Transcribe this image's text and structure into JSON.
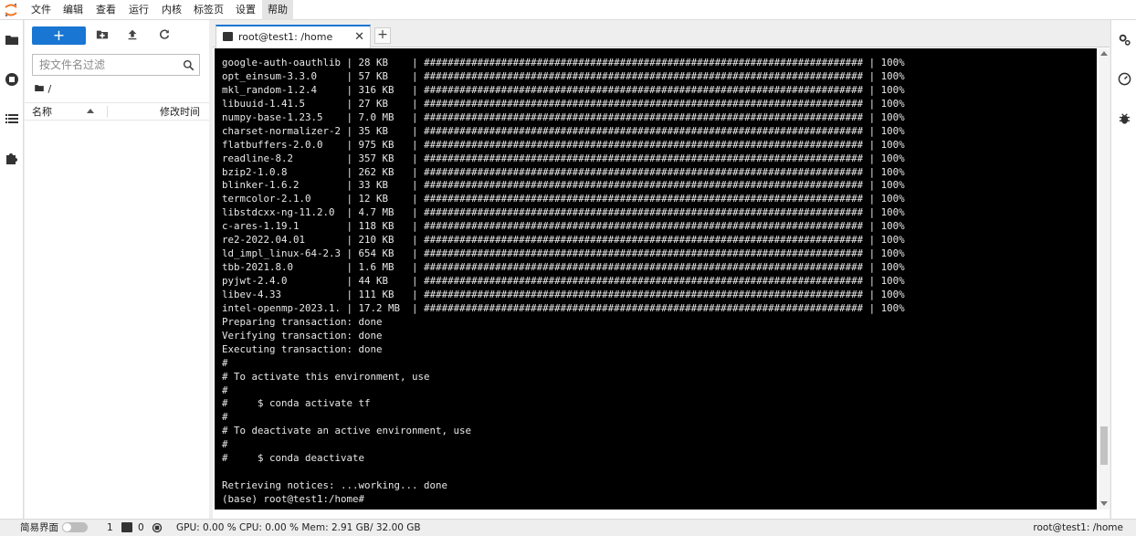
{
  "menubar": {
    "items": [
      "文件",
      "编辑",
      "查看",
      "运行",
      "内核",
      "标签页",
      "设置",
      "帮助"
    ],
    "active": "帮助"
  },
  "filebrowser": {
    "new_label": "+",
    "search_placeholder": "按文件名过滤",
    "path": "/",
    "col_name": "名称",
    "col_modified": "修改时间"
  },
  "tab": {
    "title": "root@test1: /home",
    "close": "✕",
    "add": "+"
  },
  "terminal": {
    "packages": [
      {
        "name": "google-auth-oauthlib",
        "size": "28 KB",
        "pct": "100%"
      },
      {
        "name": "opt_einsum-3.3.0",
        "size": "57 KB",
        "pct": "100%"
      },
      {
        "name": "mkl_random-1.2.4",
        "size": "316 KB",
        "pct": "100%"
      },
      {
        "name": "libuuid-1.41.5",
        "size": "27 KB",
        "pct": "100%"
      },
      {
        "name": "numpy-base-1.23.5",
        "size": "7.0 MB",
        "pct": "100%"
      },
      {
        "name": "charset-normalizer-2",
        "size": "35 KB",
        "pct": "100%"
      },
      {
        "name": "flatbuffers-2.0.0",
        "size": "975 KB",
        "pct": "100%"
      },
      {
        "name": "readline-8.2",
        "size": "357 KB",
        "pct": "100%"
      },
      {
        "name": "bzip2-1.0.8",
        "size": "262 KB",
        "pct": "100%"
      },
      {
        "name": "blinker-1.6.2",
        "size": "33 KB",
        "pct": "100%"
      },
      {
        "name": "termcolor-2.1.0",
        "size": "12 KB",
        "pct": "100%"
      },
      {
        "name": "libstdcxx-ng-11.2.0",
        "size": "4.7 MB",
        "pct": "100%"
      },
      {
        "name": "c-ares-1.19.1",
        "size": "118 KB",
        "pct": "100%"
      },
      {
        "name": "re2-2022.04.01",
        "size": "210 KB",
        "pct": "100%"
      },
      {
        "name": "ld_impl_linux-64-2.3",
        "size": "654 KB",
        "pct": "100%"
      },
      {
        "name": "tbb-2021.8.0",
        "size": "1.6 MB",
        "pct": "100%"
      },
      {
        "name": "pyjwt-2.4.0",
        "size": "44 KB",
        "pct": "100%"
      },
      {
        "name": "libev-4.33",
        "size": "111 KB",
        "pct": "100%"
      },
      {
        "name": "intel-openmp-2023.1.",
        "size": "17.2 MB",
        "pct": "100%"
      }
    ],
    "lines": [
      "Preparing transaction: done",
      "Verifying transaction: done",
      "Executing transaction: done",
      "#",
      "# To activate this environment, use",
      "#",
      "#     $ conda activate tf",
      "#",
      "# To deactivate an active environment, use",
      "#",
      "#     $ conda deactivate",
      "",
      "Retrieving notices: ...working... done",
      "(base) root@test1:/home#"
    ],
    "scroll_position": 0.92
  },
  "statusbar": {
    "simple_label": "简易界面",
    "terminals": "1",
    "kernels": "0",
    "resources": "GPU: 0.00 % CPU: 0.00 % Mem: 2.91 GB/ 32.00 GB",
    "right": "root@test1: /home"
  },
  "colors": {
    "accent": "#1976d2",
    "terminal_bg": "#000000",
    "terminal_fg": "#e8e8e8"
  }
}
